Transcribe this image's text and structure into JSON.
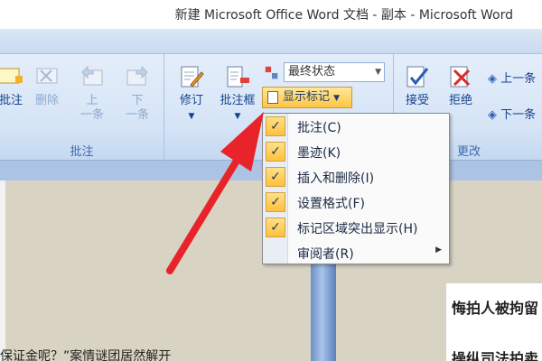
{
  "window": {
    "title": "新建 Microsoft Office Word 文档 - 副本 - Microsoft Word"
  },
  "comments_group": {
    "label": "批注",
    "items": [
      {
        "label": "批注",
        "enabled": true
      },
      {
        "label": "删除",
        "enabled": false
      },
      {
        "label": "上\n一条",
        "enabled": false
      },
      {
        "label": "下\n一条",
        "enabled": false
      }
    ]
  },
  "tracking_group": {
    "track_label": "修订",
    "balloon_label": "批注框",
    "display_combo": "最终状态",
    "show_markup_label": "显示标记"
  },
  "changes_group": {
    "label": "更改",
    "accept_label": "接受",
    "reject_label": "拒绝",
    "previous_label": "上一条",
    "next_label": "下一条"
  },
  "show_markup_menu": [
    {
      "label": "批注(C)",
      "checked": true
    },
    {
      "label": "墨迹(K)",
      "checked": true
    },
    {
      "label": "插入和删除(I)",
      "checked": true
    },
    {
      "label": "设置格式(F)",
      "checked": true
    },
    {
      "label": "标记区域突出显示(H)",
      "checked": true
    },
    {
      "label": "审阅者(R)",
      "checked": false,
      "submenu": true
    }
  ],
  "document": {
    "left_text": "保证金呢？”案情谜团居然解开",
    "right_heading_1": "悔拍人被拘留",
    "right_heading_2": "操纵司法拍卖"
  },
  "colors": {
    "highlight": "#ffc542",
    "arrow": "#e8232a"
  }
}
